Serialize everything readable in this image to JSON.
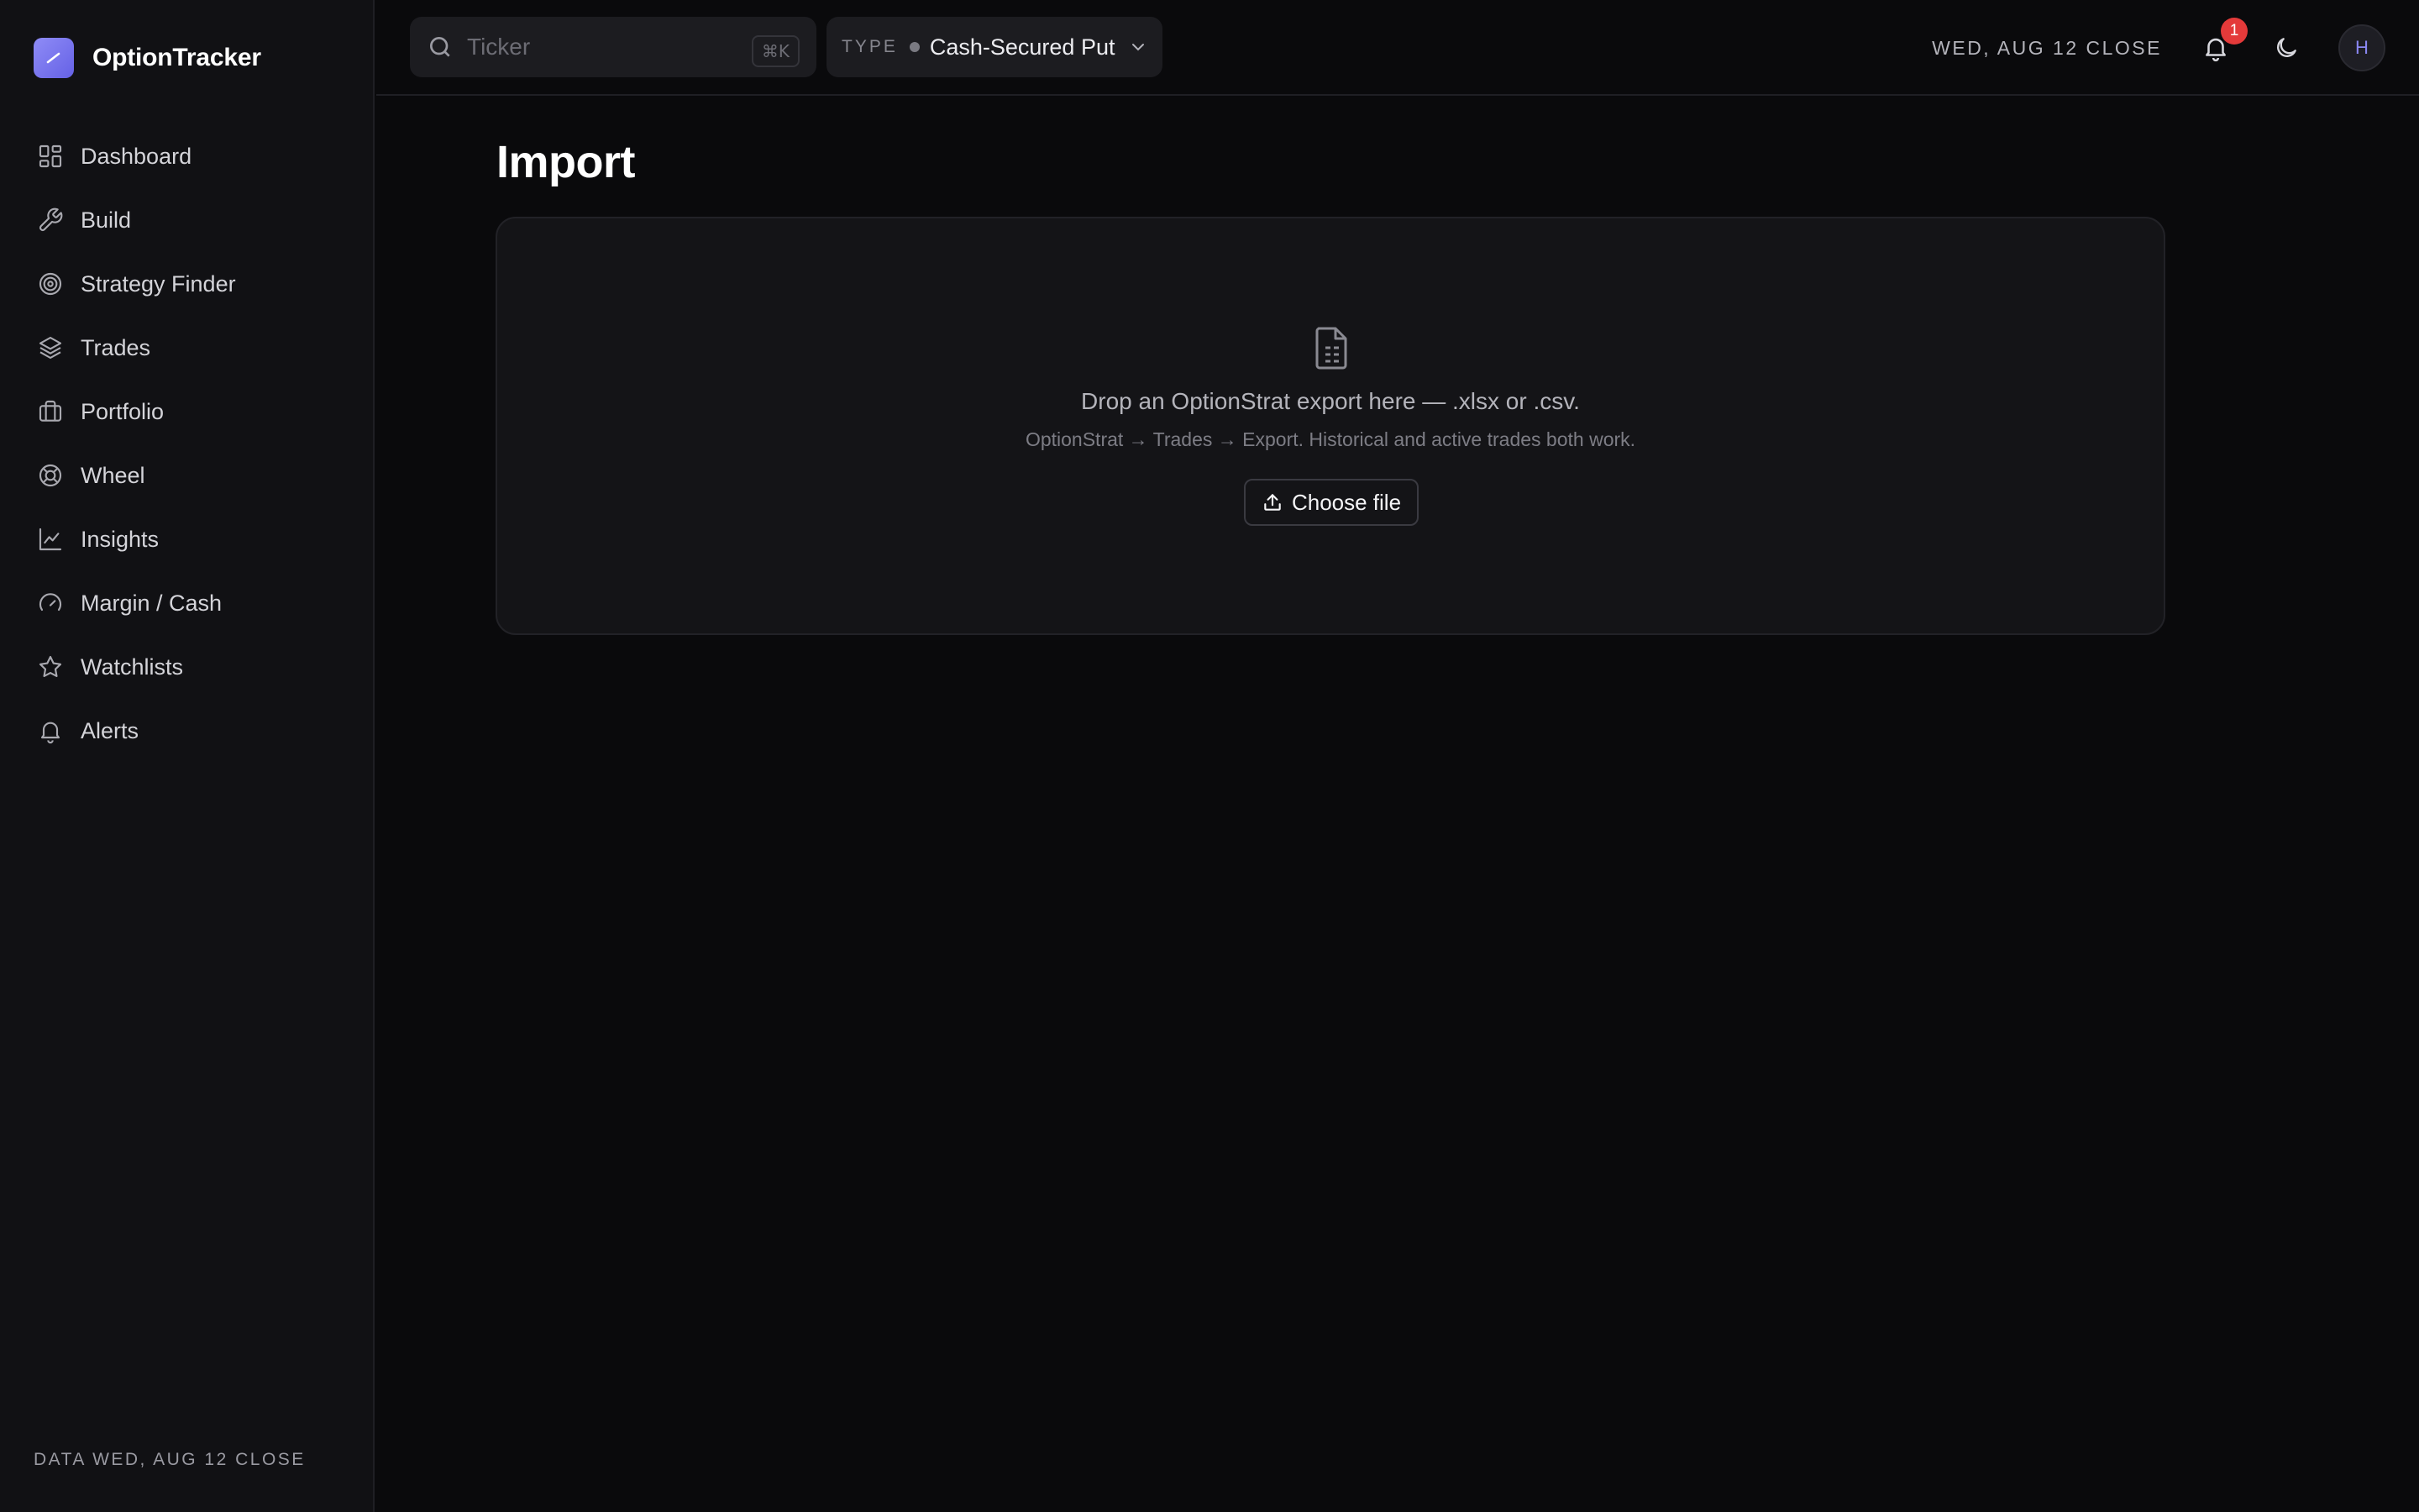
{
  "app": {
    "name": "OptionTracker",
    "accent": "#7b78f0"
  },
  "sidebar": {
    "items": [
      {
        "label": "Dashboard",
        "icon": "dashboard-icon"
      },
      {
        "label": "Build",
        "icon": "wrench-icon"
      },
      {
        "label": "Strategy Finder",
        "icon": "target-icon"
      },
      {
        "label": "Trades",
        "icon": "layers-icon"
      },
      {
        "label": "Portfolio",
        "icon": "briefcase-icon"
      },
      {
        "label": "Wheel",
        "icon": "lifebuoy-icon"
      },
      {
        "label": "Insights",
        "icon": "line-chart-icon"
      },
      {
        "label": "Margin / Cash",
        "icon": "gauge-icon"
      },
      {
        "label": "Watchlists",
        "icon": "star-icon"
      },
      {
        "label": "Alerts",
        "icon": "bell-icon"
      }
    ],
    "footer": "DATA WED, AUG 12 CLOSE"
  },
  "topbar": {
    "search": {
      "placeholder": "Ticker",
      "shortcut": "⌘K"
    },
    "type": {
      "label": "TYPE",
      "value": "Cash-Secured Put"
    },
    "close_label": "WED, AUG 12 CLOSE",
    "notifications": {
      "count": "1",
      "badge_color": "#e43a3a"
    },
    "avatar": "H"
  },
  "main": {
    "title": "Import",
    "dropzone": {
      "title": "Drop an OptionStrat export here — .xlsx or .csv.",
      "subtitle": "OptionStrat → Trades → Export. Historical and active trades both work.",
      "button": "Choose file"
    }
  }
}
